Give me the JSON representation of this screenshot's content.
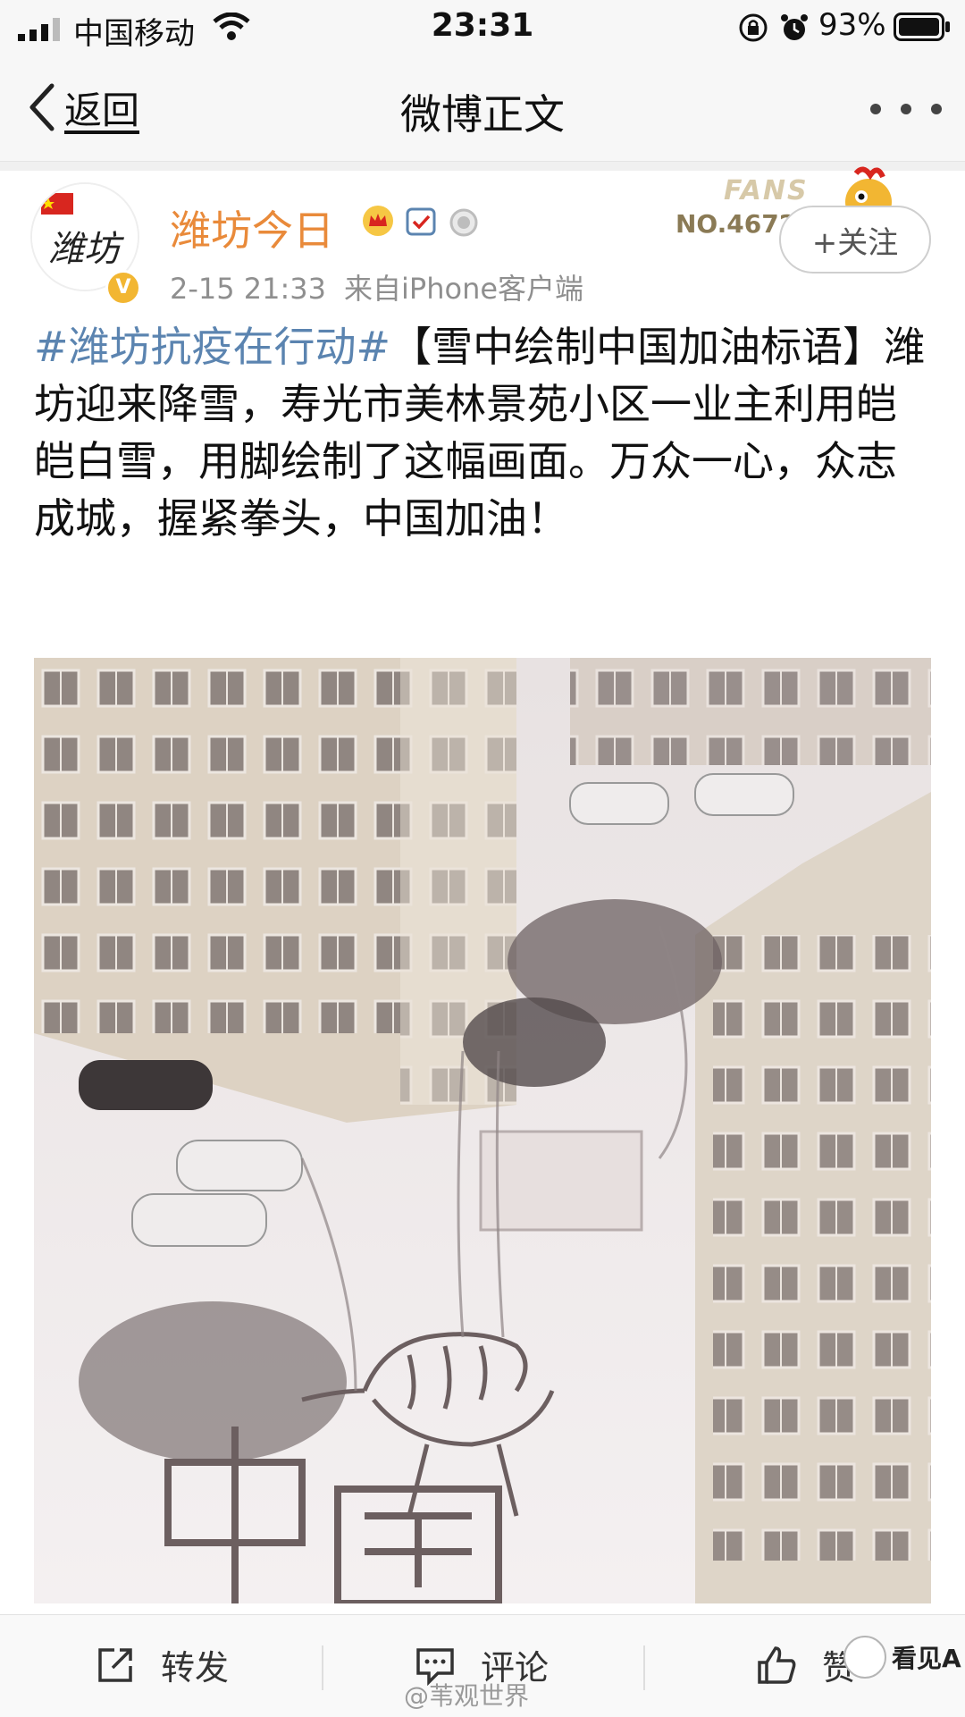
{
  "status_bar": {
    "carrier": "中国移动",
    "time": "23:31",
    "battery": "93%"
  },
  "nav": {
    "back_label": "返回",
    "title": "微博正文"
  },
  "post": {
    "username": "潍坊今日",
    "date": "2-15 21:33",
    "source": "来自iPhone客户端",
    "avatar_text": "潍坊",
    "fans_label": "FANS",
    "fans_number": "NO.46724",
    "follow_label": "+关注",
    "hashtag": "#潍坊抗疫在行动#",
    "body": "【雪中绘制中国加油标语】潍坊迎来降雪，寿光市美林景苑小区一业主利用皑皑白雪，用脚绘制了这幅画面。万众一心，众志成城，握紧拳头，中国加油！"
  },
  "footer": {
    "repost": "转发",
    "comment": "评论",
    "like": "赞"
  },
  "watermarks": {
    "center": "@苇观世界",
    "right": "看见A"
  },
  "colors": {
    "hashtag": "#5b84b0",
    "username": "#e98a3a"
  }
}
